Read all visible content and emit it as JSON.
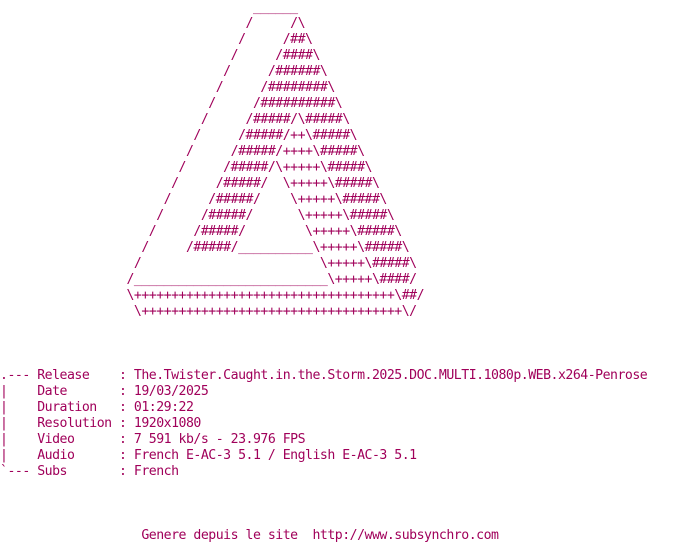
{
  "art": [
    "                                  ______",
    "                                 /     /\\",
    "                                /     /##\\",
    "                               /     /####\\",
    "                              /     /######\\",
    "                             /     /########\\",
    "                            /     /##########\\",
    "                           /     /#####/\\#####\\",
    "                          /     /#####/++\\#####\\",
    "                         /     /#####/++++\\#####\\",
    "                        /     /#####/\\+++++\\#####\\",
    "                       /     /#####/  \\+++++\\#####\\",
    "                      /     /#####/    \\+++++\\#####\\",
    "                     /     /#####/      \\+++++\\#####\\",
    "                    /     /#####/        \\+++++\\#####\\",
    "                   /     /#####/__________\\+++++\\#####\\",
    "                  /                        \\+++++\\#####\\",
    "                 /__________________________\\+++++\\####/",
    "                 \\+++++++++++++++++++++++++++++++++++\\##/",
    "                  \\+++++++++++++++++++++++++++++++++++\\/"
  ],
  "info": [
    ".--- Release    : The.Twister.Caught.in.the.Storm.2025.DOC.MULTI.1080p.WEB.x264-Penrose",
    "|    Date       : 19/03/2025",
    "|    Duration   : 01:29:22",
    "|    Resolution : 1920x1080",
    "|    Video      : 7 591 kb/s - 23.976 FPS",
    "|    Audio      : French E-AC-3 5.1 / English E-AC-3 5.1",
    "`--- Subs       : French"
  ],
  "footer": "                   Genere depuis le site  http://www.subsynchro.com"
}
